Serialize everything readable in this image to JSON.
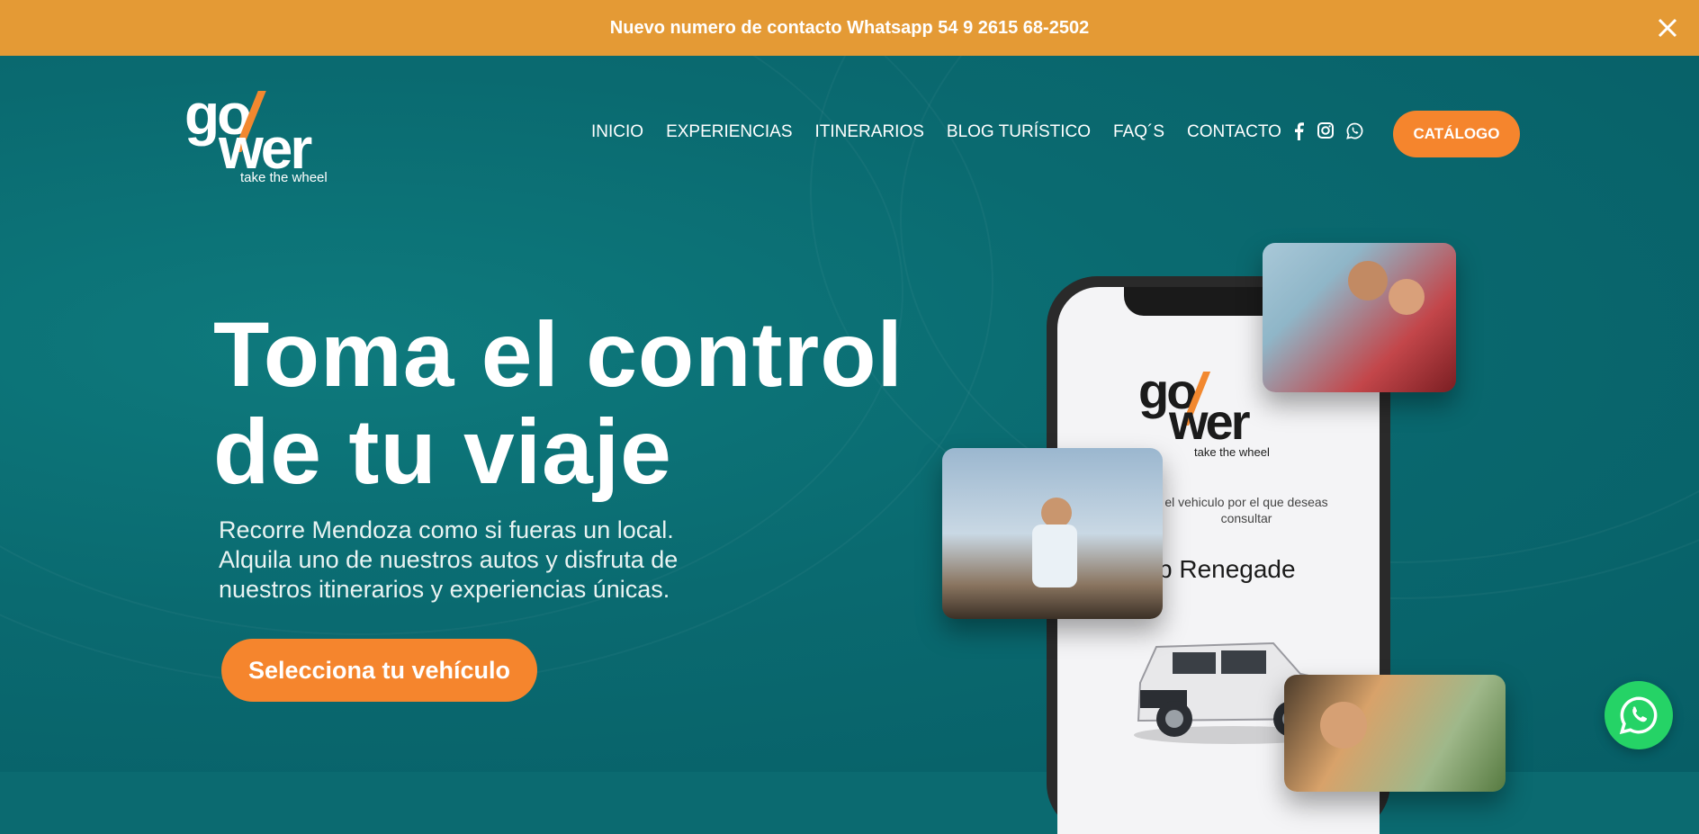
{
  "announcement": {
    "text": "Nuevo numero de contacto Whatsapp 54 9 2615 68-2502"
  },
  "logo": {
    "word1": "go",
    "word2": "wer",
    "tagline": "take the wheel"
  },
  "nav": {
    "items": [
      "INICIO",
      "EXPERIENCIAS",
      "ITINERARIOS",
      "BLOG TURÍSTICO",
      "FAQ´S",
      "CONTACTO"
    ]
  },
  "social": [
    "facebook-icon",
    "instagram-icon",
    "whatsapp-icon"
  ],
  "catalog_button": "CATÁLOGO",
  "hero": {
    "title_line1": "Toma el control",
    "title_line2": "de tu viaje",
    "subtitle_line1": "Recorre Mendoza como si fueras un local.",
    "subtitle_line2": "Alquila uno de nuestros autos y disfruta de",
    "subtitle_line3": "nuestros itinerarios y experiencias únicas.",
    "cta": "Selecciona tu vehículo"
  },
  "phone_mockup": {
    "logo_word1": "go",
    "logo_word2": "wer",
    "logo_tagline": "take the wheel",
    "prompt_line1": "el vehiculo por el que deseas",
    "prompt_line2": "consultar",
    "model": "p Renegade"
  },
  "colors": {
    "banner": "#e49a35",
    "accent": "#f5852d",
    "hero_bg": "#0b6a70",
    "whatsapp": "#25d366"
  }
}
